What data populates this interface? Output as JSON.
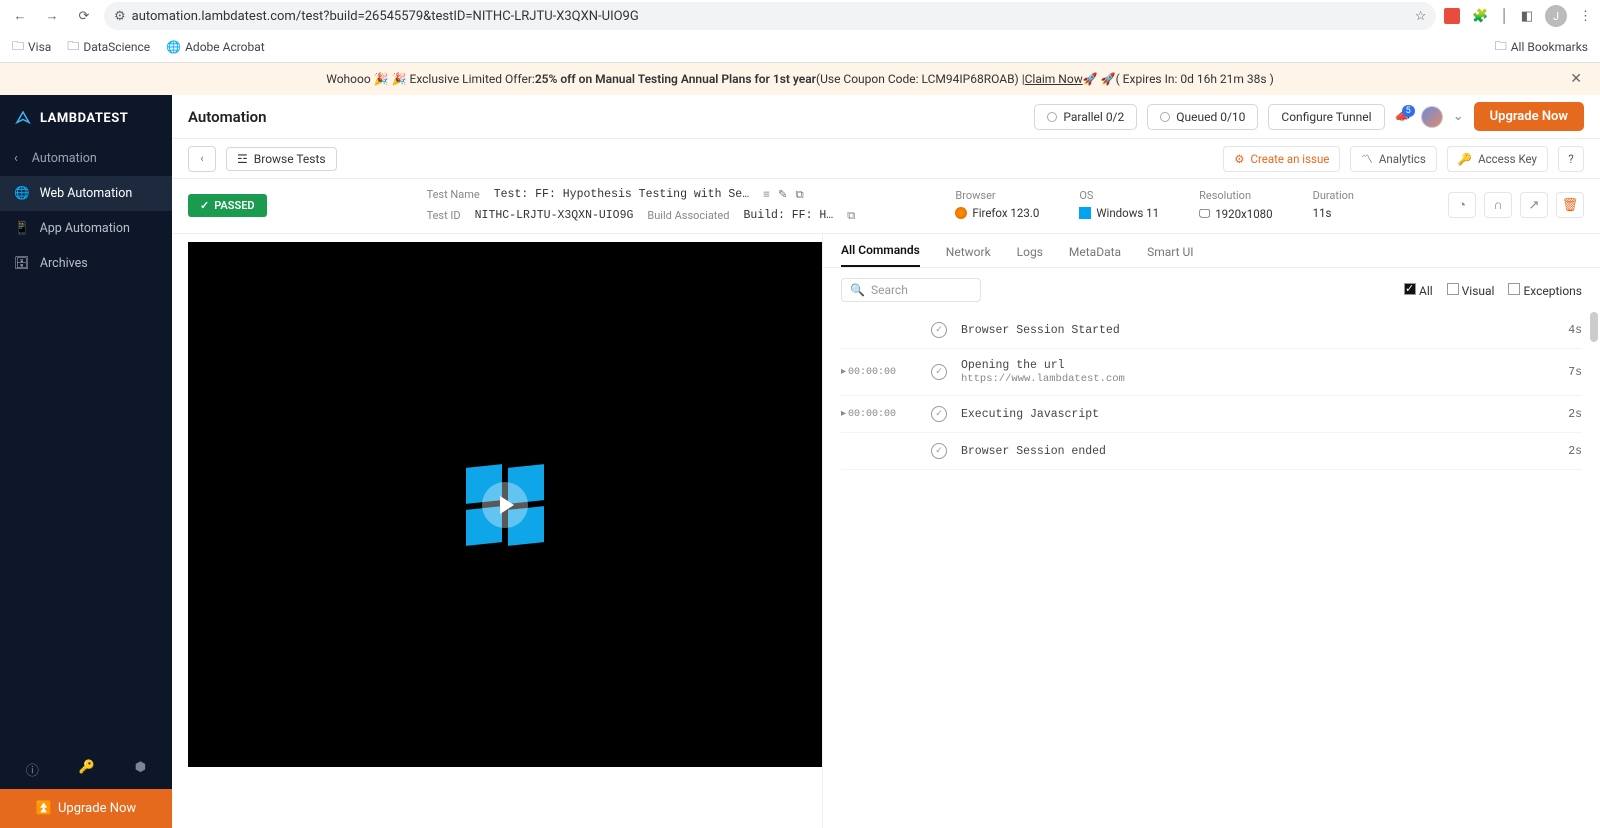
{
  "browser": {
    "url": "automation.lambdatest.com/test?build=26545579&testID=NITHC-LRJTU-X3QXN-UIO9G",
    "bookmarks": [
      "Visa",
      "DataScience",
      "Adobe Acrobat"
    ],
    "all_bookmarks": "All Bookmarks"
  },
  "promo": {
    "prefix": "Wohooo 🎉 🎉 Exclusive Limited Offer:  ",
    "bold": "25% off on Manual Testing Annual Plans for 1st year",
    "coupon": " (Use Coupon Code: LCM94IP68ROAB) | ",
    "claim": "Claim Now",
    "rockets": " 🚀 🚀 ",
    "expires": "( Expires In: 0d 16h 21m 38s )"
  },
  "brand": "LAMBDATEST",
  "sidebar": {
    "parent": "Automation",
    "items": [
      "Web Automation",
      "App Automation",
      "Archives"
    ],
    "upgrade": "Upgrade Now"
  },
  "header": {
    "title": "Automation",
    "parallel": "Parallel  0/2",
    "queued": "Queued  0/10",
    "configure": "Configure Tunnel",
    "badge": "5",
    "upgrade": "Upgrade Now"
  },
  "subheader": {
    "browse": "Browse Tests",
    "create_issue": "Create an issue",
    "analytics": "Analytics",
    "access_key": "Access Key",
    "help": "?"
  },
  "meta": {
    "passed": "PASSED",
    "test_name_label": "Test Name",
    "test_name": "Test: FF: Hypothesis Testing with Se…",
    "test_id_label": "Test ID",
    "test_id": "NITHC-LRJTU-X3QXN-UIO9G",
    "build_label": "Build Associated",
    "build": "Build: FF: H…",
    "browser_label": "Browser",
    "browser_val": "Firefox 123.0",
    "os_label": "OS",
    "os_val": "Windows 11",
    "res_label": "Resolution",
    "res_val": "1920x1080",
    "dur_label": "Duration",
    "dur_val": "11s"
  },
  "tabs": [
    "All Commands",
    "Network",
    "Logs",
    "MetaData",
    "Smart UI"
  ],
  "search_placeholder": "Search",
  "filters": {
    "all": "All",
    "visual": "Visual",
    "exceptions": "Exceptions"
  },
  "commands": [
    {
      "ts": "",
      "title": "Browser Session Started",
      "sub": "",
      "dur": "4s"
    },
    {
      "ts": "00:00:00",
      "title": "Opening the url",
      "sub": "https://www.lambdatest.com",
      "dur": "7s"
    },
    {
      "ts": "00:00:00",
      "title": "Executing Javascript",
      "sub": "",
      "dur": "2s"
    },
    {
      "ts": "",
      "title": "Browser Session ended",
      "sub": "",
      "dur": "2s"
    }
  ]
}
